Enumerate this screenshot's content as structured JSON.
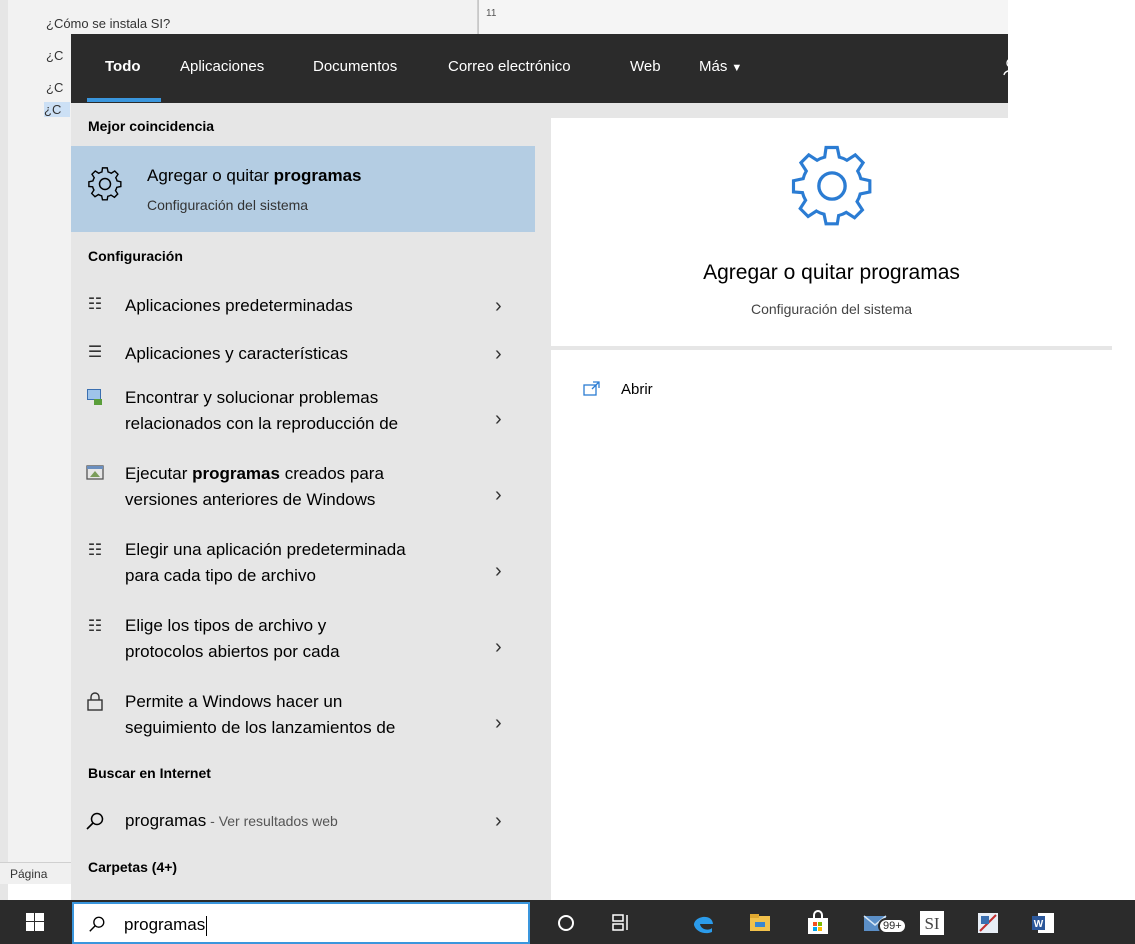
{
  "background": {
    "items": [
      "¿Cómo se instala SI?",
      "¿C",
      "¿C",
      "¿C"
    ],
    "ruler_mark": "11",
    "status_text": "Página"
  },
  "tabs": [
    {
      "label": "Todo",
      "active": true
    },
    {
      "label": "Aplicaciones"
    },
    {
      "label": "Documentos"
    },
    {
      "label": "Correo electrónico"
    },
    {
      "label": "Web"
    },
    {
      "label": "Más",
      "icon": "caret-down"
    }
  ],
  "toolbar": {
    "feedback_icon": "feedback-icon",
    "more_icon": "more-icon",
    "more_label": "···"
  },
  "best_match": {
    "header": "Mejor coincidencia",
    "title_plain": "Agregar o quitar ",
    "title_bold": "programas",
    "subtitle": "Configuración del sistema",
    "icon": "gear-icon"
  },
  "settings": {
    "header": "Configuración",
    "items": [
      {
        "line1": "Aplicaciones predeterminadas",
        "icon": "app-defaults-icon"
      },
      {
        "line1": "Aplicaciones y características",
        "icon": "apps-features-icon"
      },
      {
        "line1": "Encontrar y solucionar problemas",
        "line2": "relacionados con la reproducción de",
        "icon": "troubleshoot-icon"
      },
      {
        "line1_pre": "Ejecutar ",
        "line1_bold": "programas",
        "line1_post": " creados para",
        "line2": "versiones anteriores de Windows",
        "icon": "compat-icon"
      },
      {
        "line1": "Elegir una aplicación predeterminada",
        "line2": "para cada tipo de archivo",
        "icon": "app-defaults-icon"
      },
      {
        "line1": "Elige los tipos de archivo y",
        "line2": "protocolos abiertos por cada",
        "icon": "app-defaults-icon"
      },
      {
        "line1": "Permite a Windows hacer un",
        "line2": "seguimiento de los lanzamientos de",
        "icon": "lock-icon"
      }
    ]
  },
  "web": {
    "header": "Buscar en Internet",
    "query": "programas",
    "suffix": " - Ver resultados web"
  },
  "folders": {
    "header": "Carpetas (4+)"
  },
  "preview": {
    "title": "Agregar o quitar programas",
    "subtitle": "Configuración del sistema",
    "open_label": "Abrir"
  },
  "taskbar": {
    "search_value": "programas",
    "mail_badge": "99+",
    "items": [
      "windows-start-icon",
      "cortana-icon",
      "task-view-icon",
      "edge-icon",
      "file-explorer-icon",
      "store-icon",
      "mail-icon",
      "si-app-icon",
      "snipping-icon",
      "word-icon"
    ]
  },
  "colors": {
    "accent": "#3a96dd",
    "best_match_bg": "#b4cde3",
    "topbar_bg": "#2b2b2b"
  }
}
